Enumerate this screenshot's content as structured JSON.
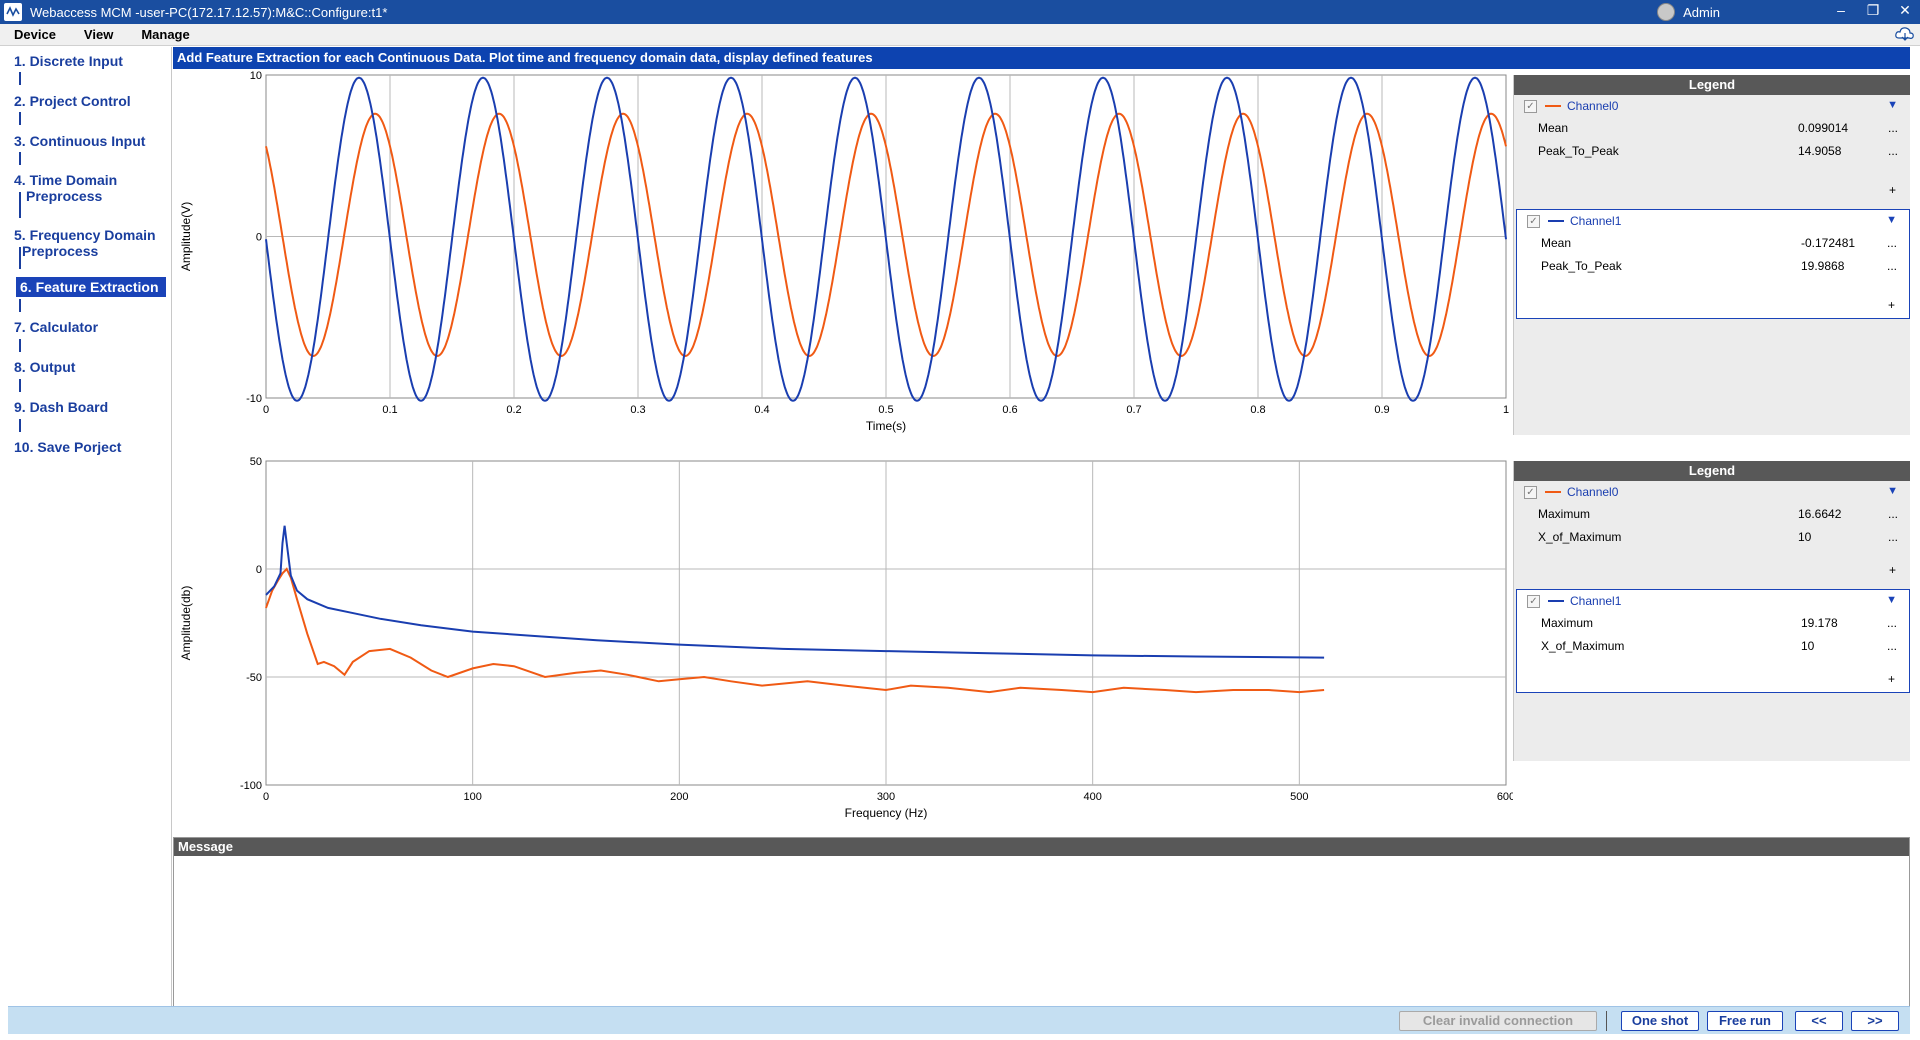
{
  "window": {
    "title": "Webaccess MCM -user-PC(172.17.12.57):M&C::Configure:t1*",
    "user": "Admin"
  },
  "menu": [
    "Device",
    "View",
    "Manage"
  ],
  "steps": [
    {
      "line1": "1. Discrete Input",
      "line2": ""
    },
    {
      "line1": "2. Project Control",
      "line2": ""
    },
    {
      "line1": "3. Continuous Input",
      "line2": ""
    },
    {
      "line1": "4. Time Domain",
      "line2": "Preprocess"
    },
    {
      "line1": "5. Frequency Domain",
      "line2": "Preprocess"
    },
    {
      "line1": "6. Feature Extraction",
      "line2": ""
    },
    {
      "line1": "7. Calculator",
      "line2": ""
    },
    {
      "line1": "8. Output",
      "line2": ""
    },
    {
      "line1": "9. Dash Board",
      "line2": ""
    },
    {
      "line1": "10. Save Porject",
      "line2": ""
    }
  ],
  "active_step": 5,
  "header": "Add Feature Extraction for each Continuous Data. Plot time and frequency domain data, display defined features",
  "colors": {
    "channel0": "#f05a14",
    "channel1": "#1a3eb0"
  },
  "chart_data": [
    {
      "type": "line",
      "xlabel": "Time(s)",
      "ylabel": "Amplitude(V)",
      "xlim": [
        0,
        1
      ],
      "ylim": [
        -10,
        10
      ],
      "x_ticks": [
        "0",
        "0.1",
        "0.2",
        "0.3",
        "0.4",
        "0.5",
        "0.6",
        "0.7",
        "0.8",
        "0.9",
        "1"
      ],
      "y_ticks": [
        "10",
        "0",
        "-10"
      ],
      "grid": true,
      "series": [
        {
          "name": "Channel0",
          "waveform": "sine",
          "frequency_hz": 10,
          "amplitude": 7.5,
          "offset": 0.1,
          "phase_deg": 133
        },
        {
          "name": "Channel1",
          "waveform": "sine",
          "frequency_hz": 10,
          "amplitude": 10,
          "offset": -0.17,
          "phase_deg": 180
        }
      ]
    },
    {
      "type": "line",
      "xlabel": "Frequency (Hz)",
      "ylabel": "Amplitude(db)",
      "xlim": [
        0,
        600
      ],
      "ylim": [
        -100,
        50
      ],
      "x_ticks": [
        "0",
        "100",
        "200",
        "300",
        "400",
        "500",
        "600"
      ],
      "y_ticks": [
        "50",
        "0",
        "-50",
        "-100"
      ],
      "grid": true,
      "series": [
        {
          "name": "Channel0",
          "x": [
            0,
            3,
            6,
            8,
            10,
            12,
            15,
            20,
            25,
            28,
            33,
            38,
            42,
            50,
            60,
            70,
            80,
            88,
            100,
            110,
            120,
            135,
            150,
            162,
            175,
            190,
            200,
            212,
            225,
            240,
            262,
            280,
            300,
            312,
            330,
            350,
            365,
            385,
            400,
            415,
            435,
            450,
            468,
            485,
            500,
            512
          ],
          "y": [
            -18,
            -10,
            -5,
            -2,
            0,
            -4,
            -14,
            -30,
            -44,
            -43,
            -45,
            -49,
            -43,
            -38,
            -37,
            -41,
            -47,
            -50,
            -46,
            -44,
            -45,
            -50,
            -48,
            -47,
            -49,
            -52,
            -51,
            -50,
            -52,
            -54,
            -52,
            -54,
            -56,
            -54,
            -55,
            -57,
            -55,
            -56,
            -57,
            -55,
            -56,
            -57,
            -56,
            -56,
            -57,
            -56
          ]
        },
        {
          "name": "Channel1",
          "x": [
            0,
            4,
            7,
            8,
            9,
            10,
            12,
            15,
            20,
            30,
            40,
            55,
            75,
            100,
            130,
            160,
            200,
            250,
            300,
            350,
            400,
            450,
            512
          ],
          "y": [
            -12,
            -8,
            -2,
            12,
            20,
            12,
            -3,
            -10,
            -14,
            -18,
            -20,
            -23,
            -26,
            -29,
            -31,
            -33,
            -35,
            -37,
            -38,
            -39,
            -40,
            -40.5,
            -41
          ]
        }
      ]
    }
  ],
  "legends": [
    {
      "title": "Legend",
      "channels": [
        {
          "name": "Channel0",
          "color": "#f05a14",
          "features": [
            {
              "name": "Mean",
              "value": "0.099014"
            },
            {
              "name": "Peak_To_Peak",
              "value": "14.9058"
            }
          ]
        },
        {
          "name": "Channel1",
          "color": "#1a3eb0",
          "features": [
            {
              "name": "Mean",
              "value": "-0.172481"
            },
            {
              "name": "Peak_To_Peak",
              "value": "19.9868"
            }
          ]
        }
      ]
    },
    {
      "title": "Legend",
      "channels": [
        {
          "name": "Channel0",
          "color": "#f05a14",
          "features": [
            {
              "name": "Maximum",
              "value": "16.6642"
            },
            {
              "name": "X_of_Maximum",
              "value": "10"
            }
          ]
        },
        {
          "name": "Channel1",
          "color": "#1a3eb0",
          "features": [
            {
              "name": "Maximum",
              "value": "19.178"
            },
            {
              "name": "X_of_Maximum",
              "value": "10"
            }
          ]
        }
      ]
    }
  ],
  "legend_more": "...",
  "legend_add": "+",
  "message_title": "Message",
  "buttons": {
    "clear_invalid": "Clear invalid connection",
    "one_shot": "One shot",
    "free_run": "Free run",
    "prev": "<<",
    "next": ">>"
  }
}
